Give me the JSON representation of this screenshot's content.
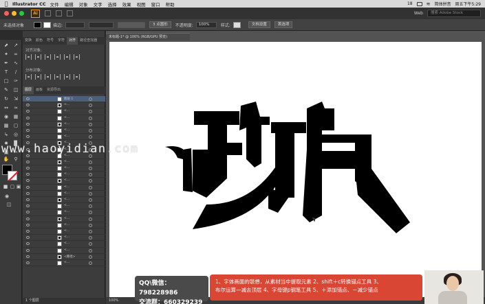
{
  "menubar": {
    "app_name": "Illustrator CC",
    "menus": [
      "文件",
      "编辑",
      "对象",
      "文字",
      "选择",
      "效果",
      "视图",
      "窗口",
      "帮助"
    ],
    "status": {
      "battery": "18",
      "clock": "周五下午5:29",
      "input": "简体拼音"
    }
  },
  "appbar": {
    "logo": "Ai",
    "workspace": "Web",
    "search_placeholder": "搜索 Adobe Stock"
  },
  "control": {
    "selection": "未选择对象",
    "stroke_label": "描边:",
    "point_label": "3 点圆形",
    "opacity_label": "不透明度:",
    "opacity_value": "100%",
    "style_label": "样式:",
    "doc_setup": "文档设置",
    "preferences": "首选项"
  },
  "panels": {
    "tabs_top": [
      "变换",
      "颜色",
      "符号",
      "字符",
      "对齐",
      "路径查找器"
    ],
    "align_objects": "对齐对象:",
    "distribute_objects": "分布对象:",
    "layers_tabs": [
      "图层",
      "画板",
      "资源导出"
    ],
    "layer_name": "图层 1",
    "layer_label": "<...",
    "path_label": "<路径>",
    "footer": "1 个图层"
  },
  "document": {
    "tab": "未标题-1* @ 100% (RGB/GPU 预览)",
    "zoom": "100%"
  },
  "watermark": "www.haoyidian.com",
  "overlay": {
    "qq": "QQ\\微信：798228986",
    "group": "交流群：660329239",
    "step_line1": "1、字体画面的联想，从素材当中提取元素  2、shift＋c转换锚点工具  3、",
    "step_line2": "布尔运算—减去顶层  4、字母键p钢笔工具  5、＋添加锚点、－减少锚点"
  },
  "colors": {
    "accent_orange": "#ff9a00",
    "overlay_red": "#d94634",
    "artwork": "#000000"
  }
}
